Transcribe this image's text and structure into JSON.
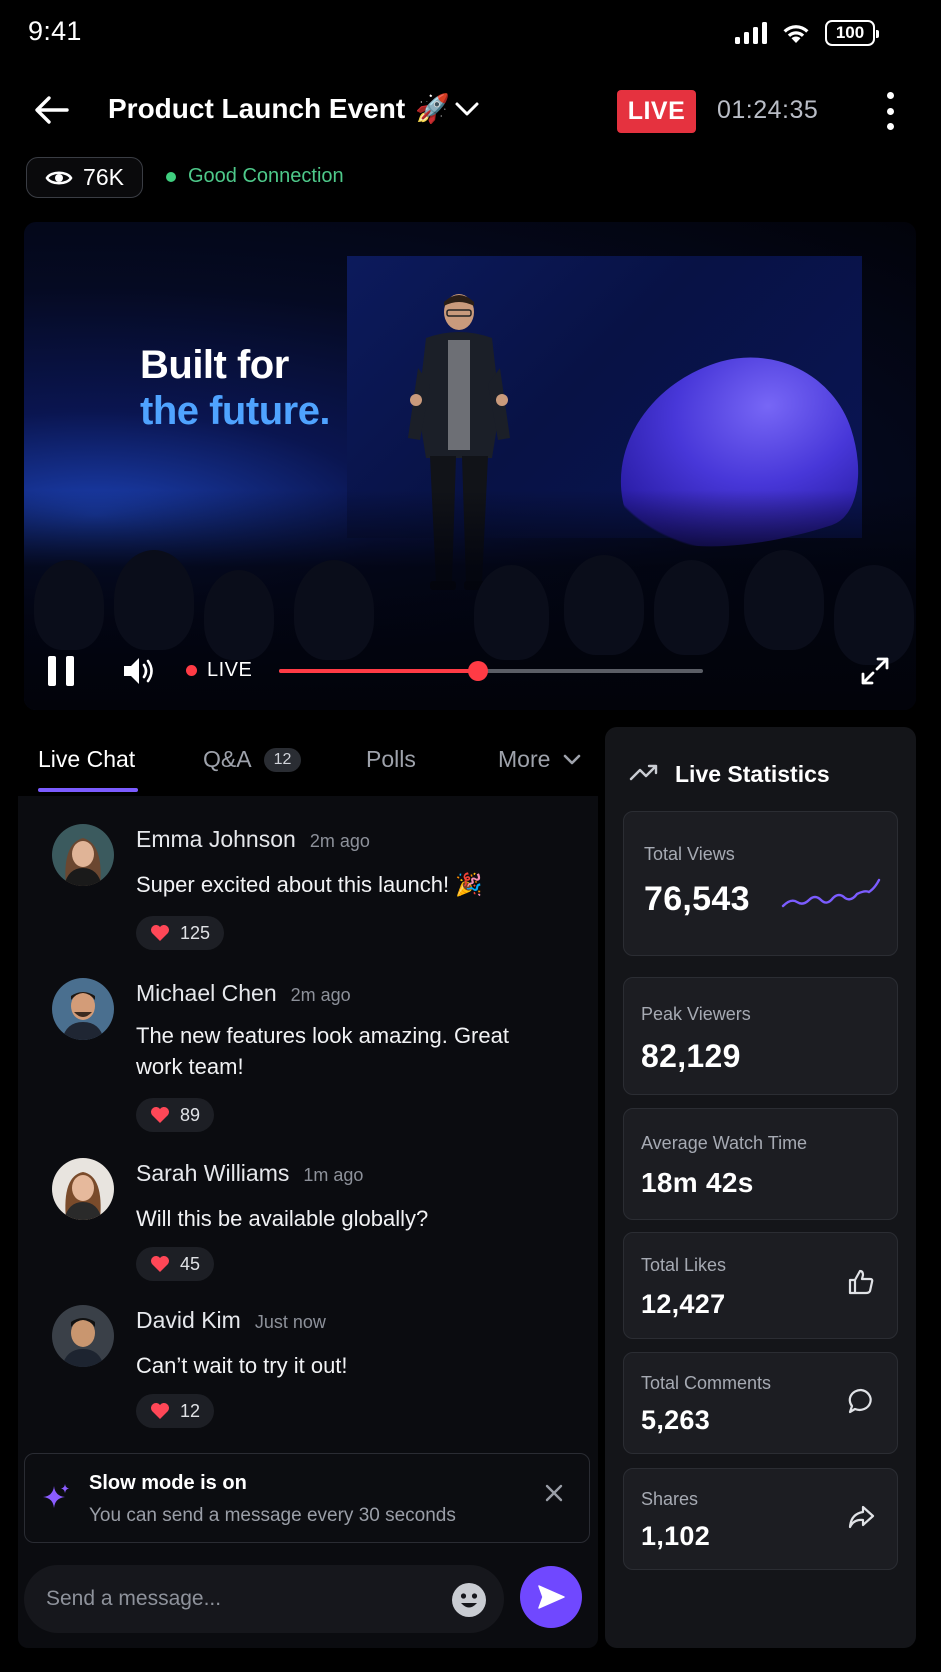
{
  "status_bar": {
    "time": "9:41",
    "battery": "100"
  },
  "header": {
    "title": "Product Launch Event",
    "title_emoji": "🚀",
    "live_label": "LIVE",
    "timer": "01:24:35",
    "viewers": "76K",
    "connection": "Good Connection"
  },
  "video": {
    "slide_line1": "Built for",
    "slide_line2": "the future.",
    "live_label": "LIVE",
    "progress": 0.47
  },
  "tabs": {
    "live_chat": "Live Chat",
    "qa": "Q&A",
    "qa_count": "12",
    "polls": "Polls",
    "more": "More"
  },
  "chat": {
    "messages": [
      {
        "name": "Emma Johnson",
        "time": "2m ago",
        "text": "Super excited about this launch! 🎉",
        "likes": "125"
      },
      {
        "name": "Michael Chen",
        "time": "2m ago",
        "text": "The new features look amazing. Great work team!",
        "likes": "89"
      },
      {
        "name": "Sarah Williams",
        "time": "1m ago",
        "text": "Will this be available globally?",
        "likes": "45"
      },
      {
        "name": "David Kim",
        "time": "Just now",
        "text": "Can’t wait to try it out!",
        "likes": "12"
      }
    ],
    "slow_mode_title": "Slow mode is on",
    "slow_mode_sub": "You can send a message every 30 seconds",
    "input_placeholder": "Send a message..."
  },
  "stats": {
    "title": "Live Statistics",
    "total_views_label": "Total Views",
    "total_views": "76,543",
    "peak_viewers_label": "Peak Viewers",
    "peak_viewers": "82,129",
    "avg_watch_label": "Average Watch Time",
    "avg_watch": "18m 42s",
    "total_likes_label": "Total Likes",
    "total_likes": "12,427",
    "total_comments_label": "Total Comments",
    "total_comments": "5,263",
    "shares_label": "Shares",
    "shares": "1,102"
  },
  "colors": {
    "live_red": "#e5323f",
    "accent_purple": "#7048ff",
    "connection_green": "#3fcf7f"
  }
}
